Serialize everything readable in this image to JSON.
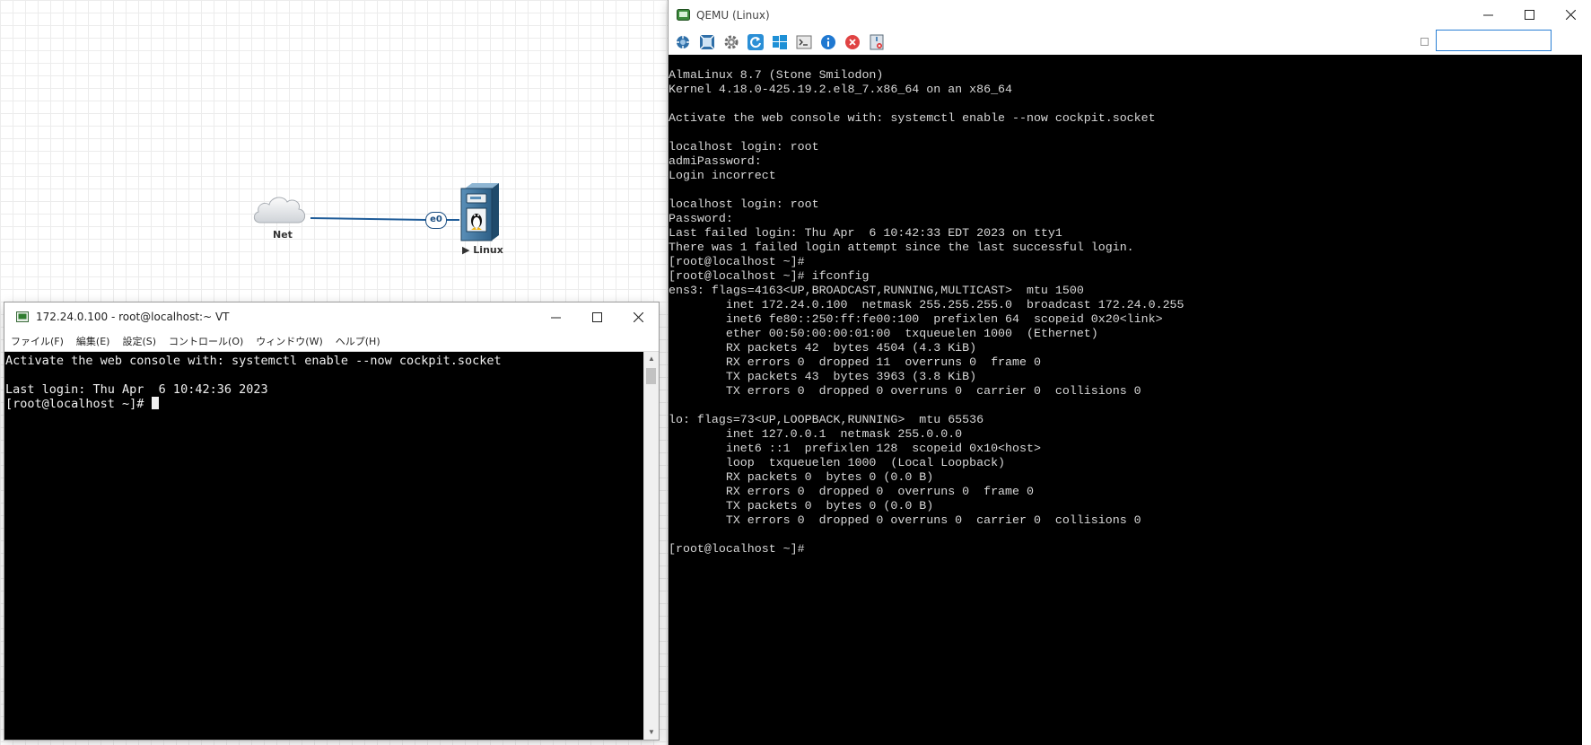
{
  "topology": {
    "cloud": {
      "label": "Net"
    },
    "vm": {
      "label": "▶ Linux"
    },
    "link": {
      "interface": "e0"
    }
  },
  "vt_window": {
    "title": "172.24.0.100 - root@localhost:~ VT",
    "menu": [
      "ファイル(F)",
      "編集(E)",
      "設定(S)",
      "コントロール(O)",
      "ウィンドウ(W)",
      "ヘルプ(H)"
    ],
    "lines": [
      "Activate the web console with: systemctl enable --now cockpit.socket",
      "",
      "Last login: Thu Apr  6 10:42:36 2023"
    ],
    "prompt": "[root@localhost ~]# "
  },
  "qemu_window": {
    "title": "QEMU (Linux)",
    "toolbar_icons": [
      "network-icon",
      "fullscreen-icon",
      "settings-gear-icon",
      "refresh-icon",
      "windows-logo-icon",
      "console-icon",
      "info-icon",
      "close-red-icon",
      "shutdown-icon"
    ],
    "search_value": "",
    "lines": [
      "AlmaLinux 8.7 (Stone Smilodon)",
      "Kernel 4.18.0-425.19.2.el8_7.x86_64 on an x86_64",
      "",
      "Activate the web console with: systemctl enable --now cockpit.socket",
      "",
      "localhost login: root",
      "admiPassword:",
      "Login incorrect",
      "",
      "localhost login: root",
      "Password:",
      "Last failed login: Thu Apr  6 10:42:33 EDT 2023 on tty1",
      "There was 1 failed login attempt since the last successful login.",
      "[root@localhost ~]#",
      "[root@localhost ~]# ifconfig",
      "ens3: flags=4163<UP,BROADCAST,RUNNING,MULTICAST>  mtu 1500",
      "        inet 172.24.0.100  netmask 255.255.255.0  broadcast 172.24.0.255",
      "        inet6 fe80::250:ff:fe00:100  prefixlen 64  scopeid 0x20<link>",
      "        ether 00:50:00:00:01:00  txqueuelen 1000  (Ethernet)",
      "        RX packets 42  bytes 4504 (4.3 KiB)",
      "        RX errors 0  dropped 11  overruns 0  frame 0",
      "        TX packets 43  bytes 3963 (3.8 KiB)",
      "        TX errors 0  dropped 0 overruns 0  carrier 0  collisions 0",
      "",
      "lo: flags=73<UP,LOOPBACK,RUNNING>  mtu 65536",
      "        inet 127.0.0.1  netmask 255.0.0.0",
      "        inet6 ::1  prefixlen 128  scopeid 0x10<host>",
      "        loop  txqueuelen 1000  (Local Loopback)",
      "        RX packets 0  bytes 0 (0.0 B)",
      "        RX errors 0  dropped 0  overruns 0  frame 0",
      "        TX packets 0  bytes 0 (0.0 B)",
      "        TX errors 0  dropped 0 overruns 0  carrier 0  collisions 0",
      "",
      "[root@localhost ~]#"
    ]
  }
}
